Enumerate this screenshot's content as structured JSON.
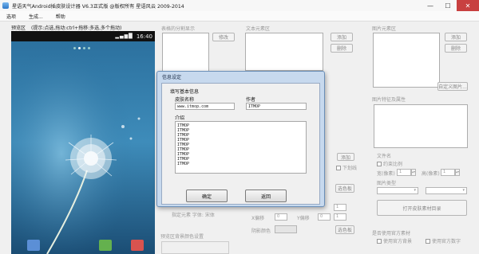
{
  "window": {
    "title": "星语天气Android插皮肤设计器 V6.3正式版 @版权所有 星语风云 2009-2014",
    "controls": [
      "—",
      "☐",
      "✕"
    ]
  },
  "menu": [
    "选项",
    "生成...",
    "帮助"
  ],
  "preview": {
    "label": "预览区",
    "hint": "(提示:点选,拖动:ctrl+拖移:多选,多个拖动)",
    "status_time": "16:40"
  },
  "panels": {
    "split_list": {
      "title": "表格的分割显示",
      "btn_modify": "修改"
    },
    "text_elem": {
      "title": "文本元素区",
      "btn_add": "添加",
      "btn_delete": "删除",
      "btn_add2": "添加",
      "chk_label": "下划线",
      "btn_select": "选色板",
      "btn_select2": "选色板"
    },
    "image_elem": {
      "title": "图片元素区",
      "btn_add": "添加",
      "btn_delete": "删除",
      "btn_custom": "自定义图片..."
    },
    "image_props": {
      "title": "图片特征及属性",
      "file_name_label": "文件名",
      "chk_fixed_ratio": "约束比例",
      "width_label": "宽(像素)",
      "width_val": "1",
      "height_label": "高(像素)",
      "height_val": "1",
      "type_label": "图片类型",
      "open_btn": "打开皮肤素材目录"
    },
    "bottom": {
      "center_hint": "指定元素 字体: 宋体",
      "bg_label": "预览区背景颜色设置",
      "x_label": "X偏移",
      "y_label": "Y偏移",
      "x_val": "0",
      "y_val": "0",
      "bg_color_label": "阴影颜色",
      "spin1": "1",
      "spin2": "1",
      "official_label": "是否使用官方素材",
      "chk_official_bg": "使用官方背景",
      "chk_official_num": "使用官方数字"
    }
  },
  "dialog": {
    "title": "信息设定",
    "section": "填写基本信息",
    "skin_name_label": "皮肤名称",
    "skin_name_value": "www.itmop.com",
    "author_label": "作者",
    "author_value": "ITMOP",
    "intro_label": "介绍",
    "intro_lines": "ITMOP\nITMOP\nITMOP\nITMOP\nITMOP\nITMOP\nITMOP\nITMOP\nITMOP",
    "ok_button": "确定",
    "cancel_button": "返回"
  },
  "colors": {
    "accent": "#2f78c8",
    "close": "#c84040",
    "dialog_frame": "#c7d9ee"
  }
}
